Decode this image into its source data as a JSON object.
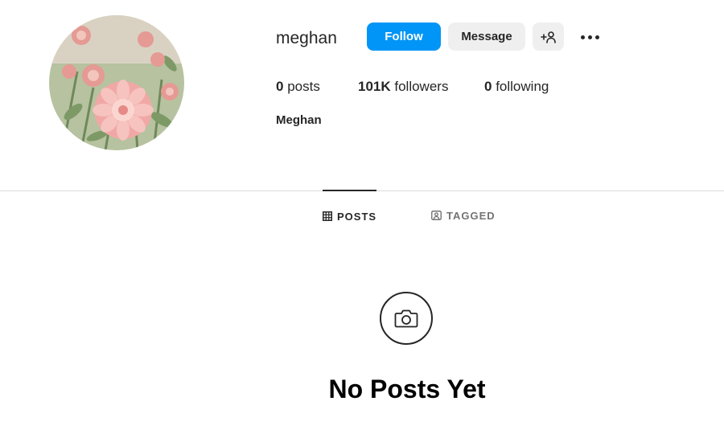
{
  "profile": {
    "username": "meghan",
    "full_name": "Meghan",
    "avatar_icon": "flower-photo"
  },
  "actions": {
    "follow_label": "Follow",
    "message_label": "Message",
    "suggest_label": "+☺",
    "suggest_icon": "add-person-icon",
    "more_icon": "more-options-icon"
  },
  "stats": {
    "posts_count": "0",
    "posts_label": "posts",
    "followers_count": "101K",
    "followers_label": "followers",
    "following_count": "0",
    "following_label": "following"
  },
  "tabs": [
    {
      "label": "POSTS",
      "icon": "grid-icon",
      "active": true
    },
    {
      "label": "TAGGED",
      "icon": "tagged-icon",
      "active": false
    }
  ],
  "empty_state": {
    "icon": "camera-icon",
    "title": "No Posts Yet"
  },
  "colors": {
    "accent": "#0095f6",
    "secondary_button": "#efefef",
    "text": "#262626",
    "muted": "#737373",
    "divider": "#dbdbdb"
  }
}
